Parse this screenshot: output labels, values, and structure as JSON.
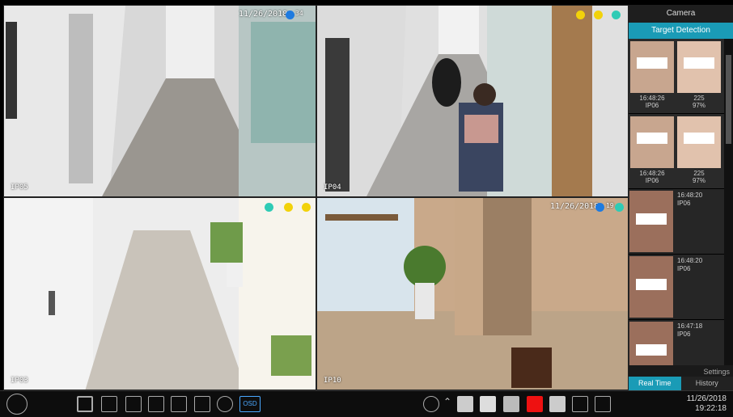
{
  "tiles": [
    {
      "timestamp": "11/26/2018",
      "extra": "34",
      "channel": "IP05"
    },
    {
      "timestamp": "",
      "extra": "",
      "channel": "IP04"
    },
    {
      "timestamp": "",
      "extra": "",
      "channel": "IP03"
    },
    {
      "timestamp": "11/26/2018",
      "extra": "19",
      "channel": "IP10"
    }
  ],
  "sidebar": {
    "title": "Camera",
    "tab": "Target Detection",
    "pairs": [
      {
        "time": "16:48:26",
        "cam": "IP06",
        "score": "225",
        "pct": "97%"
      },
      {
        "time": "16:48:26",
        "cam": "IP06",
        "score": "225",
        "pct": "97%"
      }
    ],
    "singles": [
      {
        "time": "16:48:20",
        "cam": "IP06"
      },
      {
        "time": "16:48:20",
        "cam": "IP06"
      },
      {
        "time": "16:47:18",
        "cam": "IP06"
      }
    ],
    "settings": "Settings",
    "realtime": "Real Time",
    "history": "History"
  },
  "taskbar": {
    "osd": "OSD"
  },
  "clock": {
    "date": "11/26/2018",
    "time": "19:22:18"
  },
  "colors": {
    "accent": "#1a9bb6",
    "blue_dot": "#1e7be0",
    "yellow_dot": "#f2d20a",
    "teal_icon": "#2ecbb5"
  }
}
